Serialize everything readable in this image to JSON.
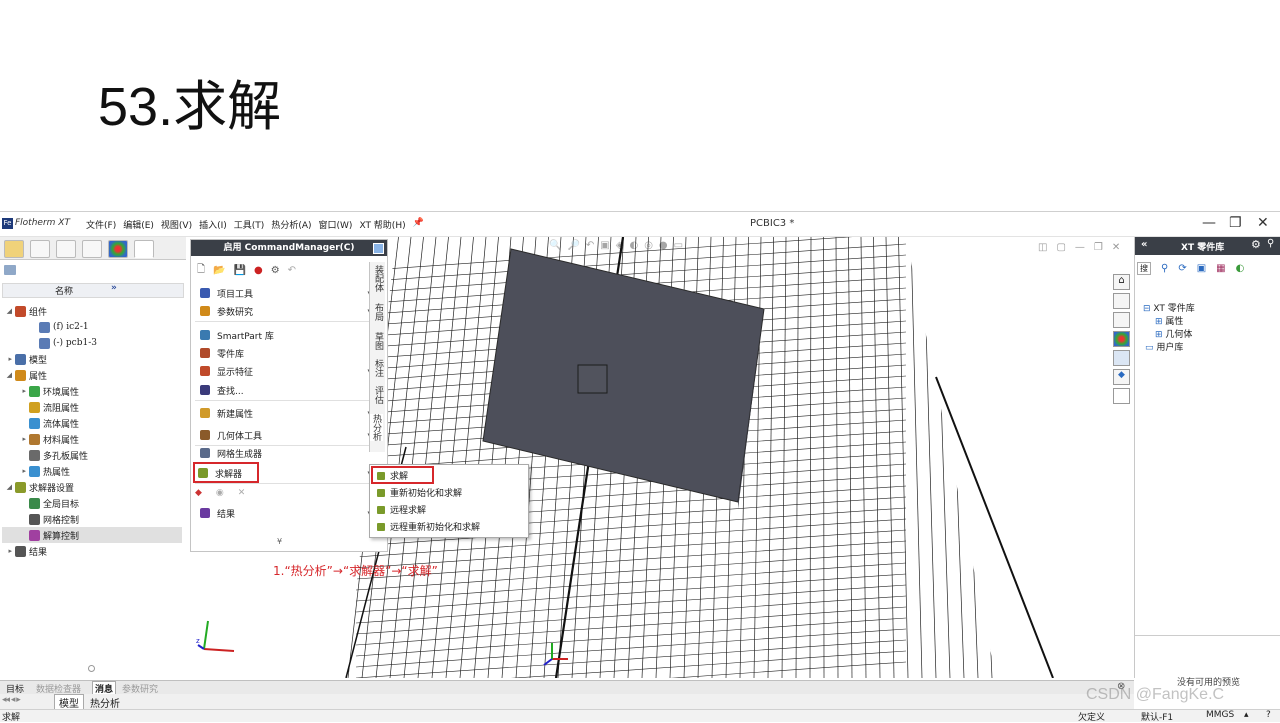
{
  "slide": {
    "title": "53.求解"
  },
  "window": {
    "app_name": "Flotherm XT",
    "doc_title": "PCBIC3 *",
    "menu": [
      "文件(F)",
      "编辑(E)",
      "视图(V)",
      "插入(I)",
      "工具(T)",
      "热分析(A)",
      "窗口(W)",
      "XT 帮助(H)"
    ]
  },
  "tree": {
    "header": "名称",
    "items": [
      {
        "label": "组件",
        "level": 0,
        "color": "#c24a2a"
      },
      {
        "label": "(f) ic2-1",
        "level": 2,
        "color": "#5a7bb5"
      },
      {
        "label": "(-) pcb1-3",
        "level": 2,
        "color": "#5a7bb5"
      },
      {
        "label": "模型",
        "level": 0,
        "color": "#4a6fa8"
      },
      {
        "label": "属性",
        "level": 0,
        "color": "#d08a1a"
      },
      {
        "label": "环境属性",
        "level": 1,
        "color": "#3aa648"
      },
      {
        "label": "流阻属性",
        "level": 1,
        "color": "#d0a020"
      },
      {
        "label": "流体属性",
        "level": 1,
        "color": "#3a90d0"
      },
      {
        "label": "材料属性",
        "level": 1,
        "color": "#b07830"
      },
      {
        "label": "多孔板属性",
        "level": 1,
        "color": "#6a6a6a"
      },
      {
        "label": "热属性",
        "level": 1,
        "color": "#3a90d0"
      },
      {
        "label": "求解器设置",
        "level": 0,
        "color": "#8a9a2a"
      },
      {
        "label": "全局目标",
        "level": 1,
        "color": "#3a8a4a"
      },
      {
        "label": "网格控制",
        "level": 1,
        "color": "#555555"
      },
      {
        "label": "解算控制",
        "level": 1,
        "color": "#a040a0"
      },
      {
        "label": "结果",
        "level": 0,
        "color": "#555555"
      }
    ]
  },
  "command_manager": {
    "title": "启用 CommandManager(C)",
    "items": [
      "项目工具",
      "参数研究",
      "SmartPart 库",
      "零件库",
      "显示特征",
      "查找...",
      "新建属性",
      "几何体工具",
      "网格生成器",
      "求解器",
      "结果"
    ],
    "vertical_tabs": [
      "装配体",
      "布局",
      "草图",
      "标注",
      "评估",
      "热分析"
    ]
  },
  "solver_submenu": {
    "items": [
      "求解",
      "重新初始化和求解",
      "远程求解",
      "远程重新初始化和求解"
    ]
  },
  "annotation": "1.“热分析”→“求解器”→“求解”",
  "right_panel": {
    "title": "XT 零件库",
    "tree": [
      "XT 零件库",
      "属性",
      "几何体",
      "用户库"
    ],
    "footer": "没有可用的预览"
  },
  "bottom": {
    "tabs": [
      "目标",
      "数据检查器",
      "消息",
      "参数研究"
    ],
    "model_tabs": [
      "模型",
      "热分析"
    ]
  },
  "status": {
    "left": "求解",
    "items": [
      "欠定义",
      "默认-F1",
      "MMGS"
    ]
  },
  "watermark": "CSDN @FangKe.C"
}
